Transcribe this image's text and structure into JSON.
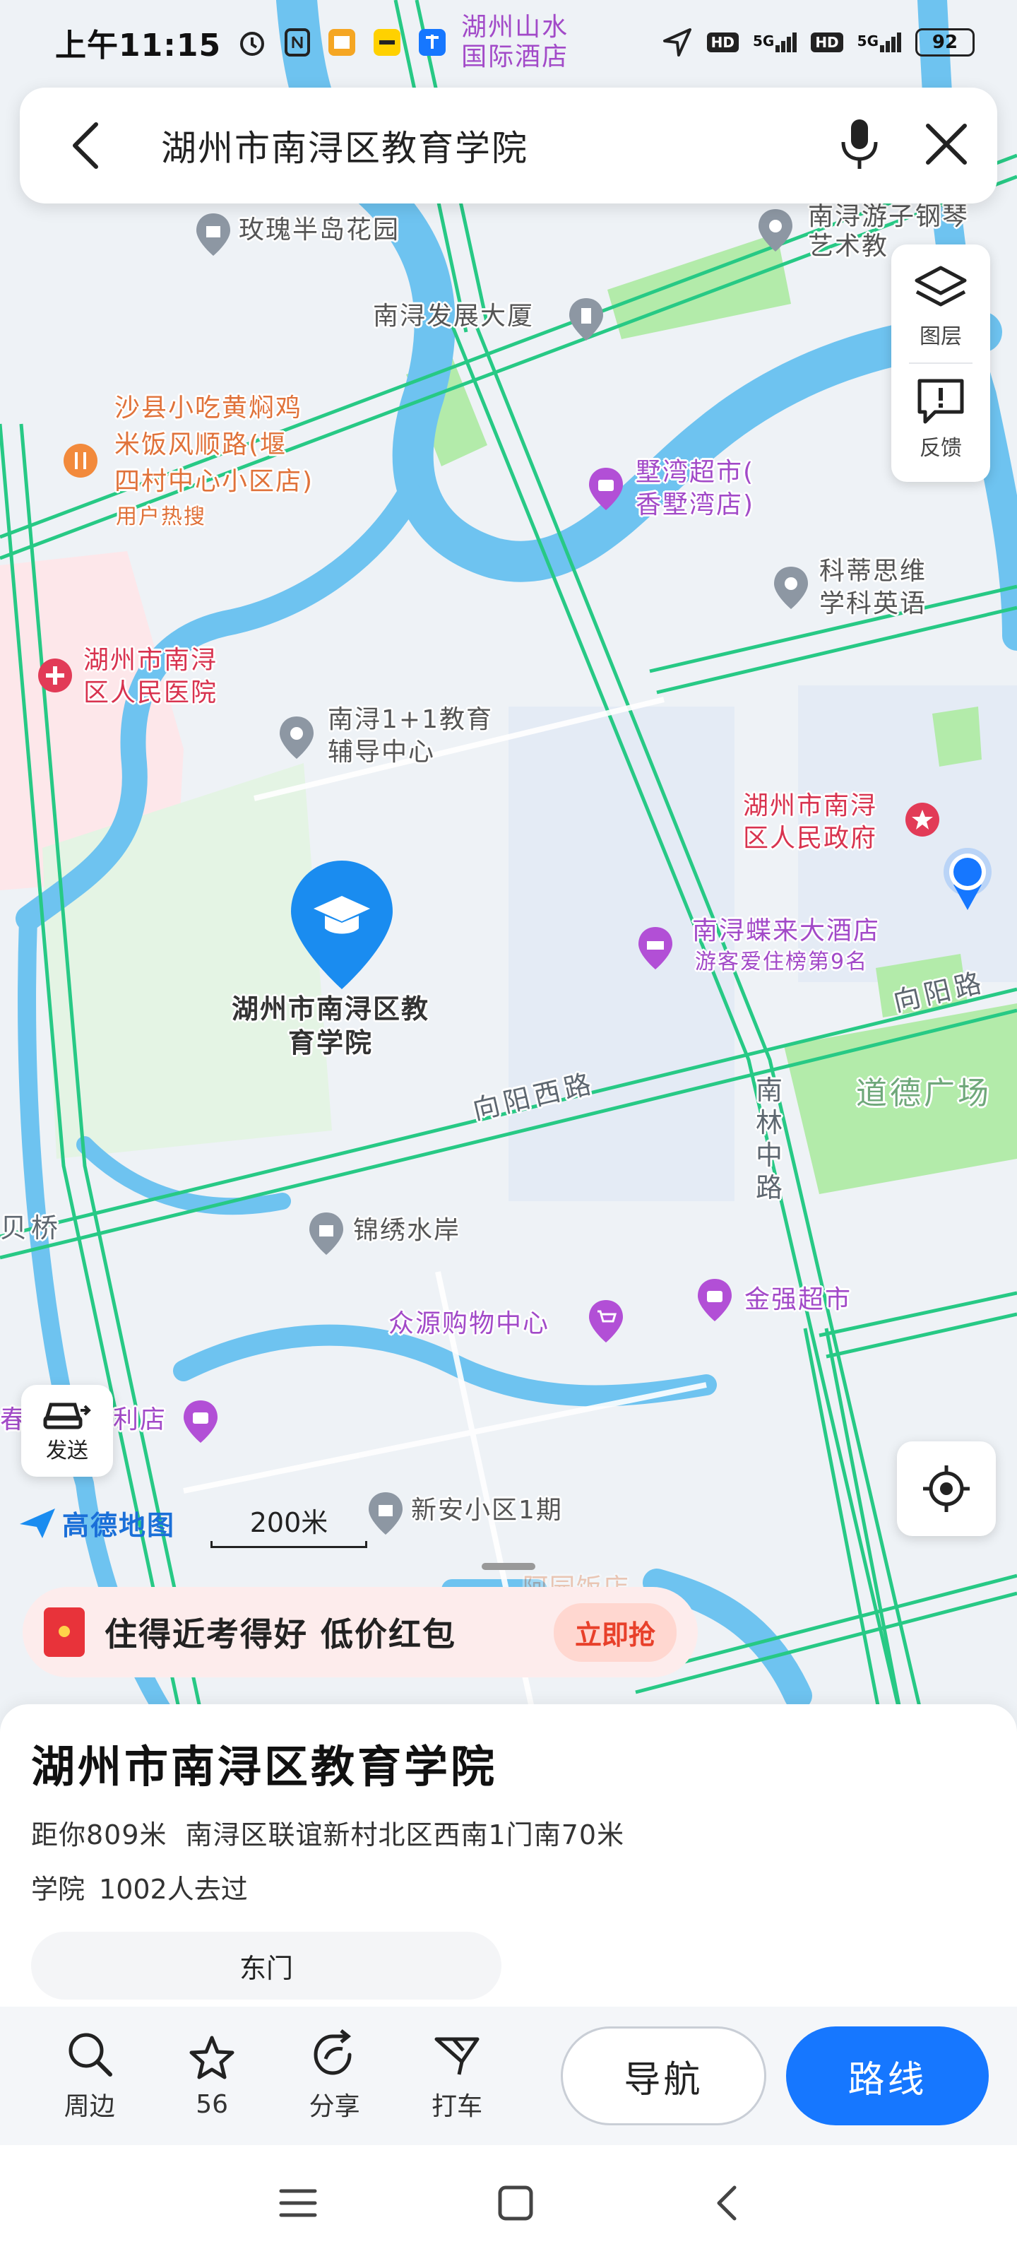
{
  "status_bar": {
    "time": "上午11:15",
    "network_left": "5G",
    "network_right": "5G",
    "battery": "92",
    "map_overlay_label": "湖州山水\n国际酒店"
  },
  "search": {
    "query": "湖州市南浔区教育学院"
  },
  "map_controls": {
    "layers_label": "图层",
    "feedback_label": "反馈",
    "send_label": "发送",
    "scale_label": "200米",
    "brand": "高德地图"
  },
  "map_labels": {
    "rose_garden": "玫瑰半岛花园",
    "piano": "南浔游子钢琴\n艺术教",
    "dev_building": "南浔发展大厦",
    "shaxian_1": "沙县小吃黄焖鸡",
    "shaxian_2": "米饭风顺路(堰",
    "shaxian_3": "四村中心小区店)",
    "hot_search": "用户热搜",
    "shuwan": "墅湾超市(\n香墅湾店)",
    "keti": "科蒂思维\n学科英语",
    "hospital": "湖州市南浔\n区人民医院",
    "tutoring": "南浔1+1教育\n辅导中心",
    "govt": "湖州市南浔\n区人民政府",
    "hotel": "南浔蝶来大酒店",
    "hotel_sub": "游客爱住榜第9名",
    "selected_poi": "湖州市南浔区教\n育学院",
    "xiangyang_road": "向阳路",
    "xiangyang_west": "向阳西路",
    "square": "道德广场",
    "nanlin": "南\n林\n中\n路",
    "bridge": "贝桥",
    "jinxiu": "锦绣水岸",
    "jinqiang": "金强超市",
    "zhongyuan": "众源购物中心",
    "shop_left": "春",
    "shop_left2": "利店",
    "xinan": "新安小区1期",
    "hidden": "阿园饭店"
  },
  "promo": {
    "text": "住得近考得好 低价红包",
    "button": "立即抢"
  },
  "place": {
    "name": "湖州市南浔区教育学院",
    "distance": "距你809米",
    "address": "南浔区联谊新村北区西南1门南70米",
    "category": "学院",
    "visits": "1002人去过",
    "entrance": "东门"
  },
  "actions": {
    "nearby": "周边",
    "favorite_count": "56",
    "share": "分享",
    "taxi": "打车",
    "navigate": "导航",
    "route": "路线"
  },
  "colors": {
    "accent": "#1677ff",
    "road": "#27c985",
    "water": "#6ec3f0",
    "green": "#b3ebaa"
  }
}
